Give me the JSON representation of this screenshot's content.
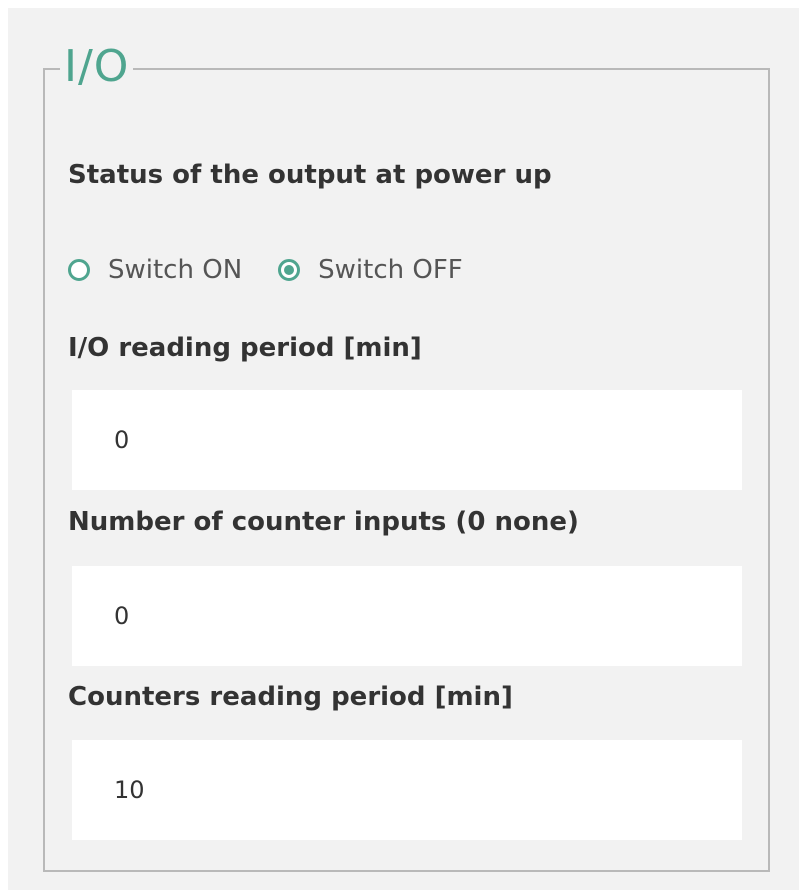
{
  "section": {
    "legend": "I/O"
  },
  "output_status": {
    "label": "Status of the output at power up",
    "options": [
      {
        "label": "Switch ON",
        "checked": false
      },
      {
        "label": "Switch OFF",
        "checked": true
      }
    ]
  },
  "io_reading_period": {
    "label": "I/O reading period [min]",
    "value": "0"
  },
  "counter_inputs": {
    "label": "Number of counter inputs (0 none)",
    "value": "0"
  },
  "counters_reading_period": {
    "label": "Counters reading period [min]",
    "value": "10"
  },
  "colors": {
    "accent": "#4fa58f",
    "background": "#f2f2f2",
    "border": "#b9b9b9"
  }
}
